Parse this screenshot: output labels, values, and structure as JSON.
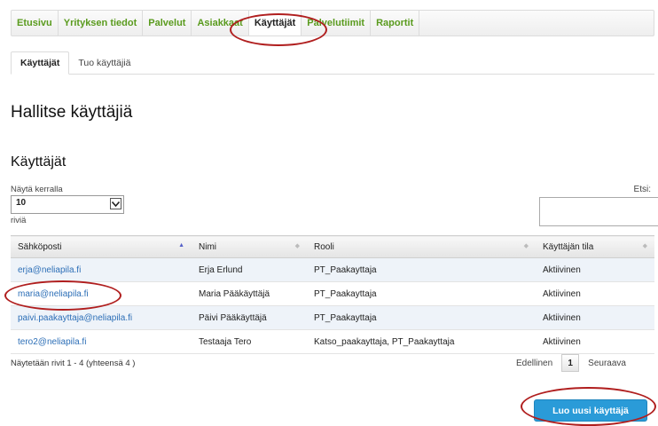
{
  "nav": {
    "items": [
      "Etusivu",
      "Yrityksen tiedot",
      "Palvelut",
      "Asiakkaat",
      "Käyttäjät",
      "Palvelutiimit",
      "Raportit"
    ],
    "active": "Käyttäjät"
  },
  "subtabs": [
    "Käyttäjät",
    "Tuo käyttäjiä"
  ],
  "page_title": "Hallitse käyttäjiä",
  "section_title": "Käyttäjät",
  "page_size": {
    "label": "Näytä kerralla",
    "value": "10",
    "suffix": "riviä"
  },
  "search": {
    "label": "Etsi:",
    "value": ""
  },
  "table": {
    "headers": [
      "Sähköposti",
      "Nimi",
      "Rooli",
      "Käyttäjän tila"
    ],
    "rows": [
      {
        "email": "erja@neliapila.fi",
        "name": "Erja Erlund",
        "role": "PT_Paakayttaja",
        "status": "Aktiivinen"
      },
      {
        "email": "maria@neliapila.fi",
        "name": "Maria Pääkäyttäjä",
        "role": "PT_Paakayttaja",
        "status": "Aktiivinen"
      },
      {
        "email": "paivi.paakayttaja@neliapila.fi",
        "name": "Päivi Pääkäyttäjä",
        "role": "PT_Paakayttaja",
        "status": "Aktiivinen"
      },
      {
        "email": "tero2@neliapila.fi",
        "name": "Testaaja Tero",
        "role": "Katso_paakayttaja, PT_Paakayttaja",
        "status": "Aktiivinen"
      }
    ]
  },
  "footer": {
    "info": "Näytetään rivit 1 - 4 (yhteensä 4 )",
    "prev": "Edellinen",
    "page": "1",
    "next": "Seuraava"
  },
  "new_user_button": "Luo uusi käyttäjä",
  "colors": {
    "nav_link": "#5a9b1e",
    "email_link": "#2d6fb7",
    "button": "#2a9bd8",
    "annotation": "#b01e1e"
  }
}
